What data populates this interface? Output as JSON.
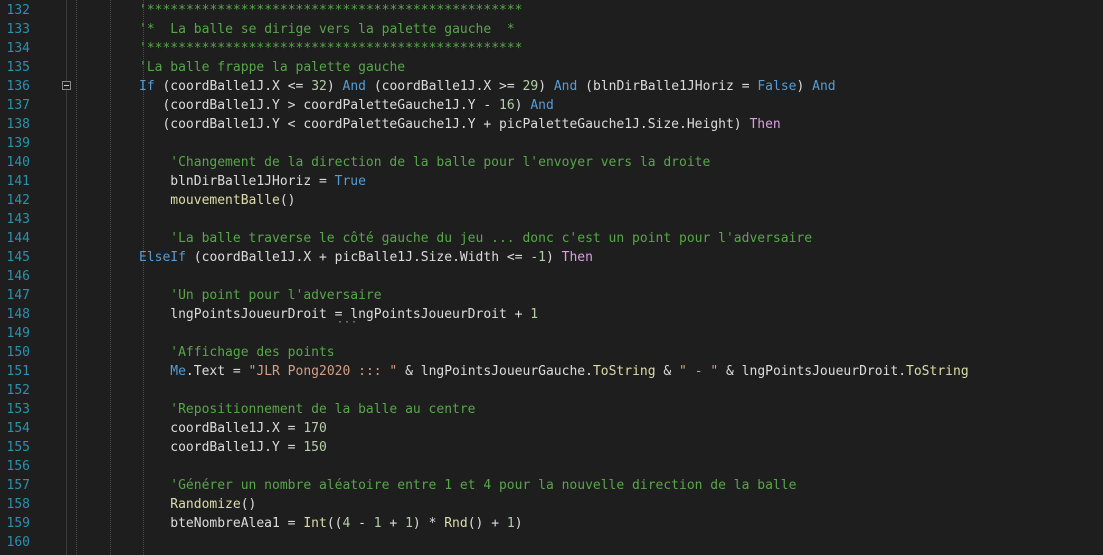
{
  "editor": {
    "lines": [
      {
        "n": "132",
        "indent": 0,
        "tokens": [
          {
            "t": "c",
            "v": "'************************************************"
          }
        ]
      },
      {
        "n": "133",
        "indent": 0,
        "tokens": [
          {
            "t": "c",
            "v": "'*  La balle se dirige vers la palette gauche  *"
          }
        ]
      },
      {
        "n": "134",
        "indent": 0,
        "tokens": [
          {
            "t": "c",
            "v": "'************************************************"
          }
        ]
      },
      {
        "n": "135",
        "indent": 0,
        "tokens": [
          {
            "t": "c",
            "v": "'La balle frappe la palette gauche"
          }
        ]
      },
      {
        "n": "136",
        "indent": 0,
        "fold": true,
        "tokens": [
          {
            "t": "k",
            "v": "If"
          },
          {
            "t": "x",
            "v": " (coordBalle1J.X <= "
          },
          {
            "t": "n",
            "v": "32"
          },
          {
            "t": "x",
            "v": ") "
          },
          {
            "t": "k",
            "v": "And"
          },
          {
            "t": "x",
            "v": " (coordBalle1J.X >= "
          },
          {
            "t": "n",
            "v": "29"
          },
          {
            "t": "x",
            "v": ") "
          },
          {
            "t": "k",
            "v": "And"
          },
          {
            "t": "x",
            "v": " (blnDirBalle1JHoriz = "
          },
          {
            "t": "k",
            "v": "False"
          },
          {
            "t": "x",
            "v": ") "
          },
          {
            "t": "k",
            "v": "And"
          }
        ]
      },
      {
        "n": "137",
        "indent": 3,
        "tokens": [
          {
            "t": "x",
            "v": "(coordBalle1J.Y > coordPaletteGauche1J.Y - "
          },
          {
            "t": "n",
            "v": "16"
          },
          {
            "t": "x",
            "v": ") "
          },
          {
            "t": "k",
            "v": "And"
          }
        ]
      },
      {
        "n": "138",
        "indent": 3,
        "tokens": [
          {
            "t": "x",
            "v": "(coordBalle1J.Y < coordPaletteGauche1J.Y + picPaletteGauche1J.Size.Height) "
          },
          {
            "t": "p",
            "v": "Then"
          }
        ]
      },
      {
        "n": "139",
        "indent": 0,
        "tokens": []
      },
      {
        "n": "140",
        "indent": 4,
        "tokens": [
          {
            "t": "c",
            "v": "'Changement de la direction de la balle pour l'envoyer vers la droite"
          }
        ]
      },
      {
        "n": "141",
        "indent": 4,
        "tokens": [
          {
            "t": "x",
            "v": "blnDirBalle1JHoriz = "
          },
          {
            "t": "k",
            "v": "True"
          }
        ]
      },
      {
        "n": "142",
        "indent": 4,
        "tokens": [
          {
            "t": "m",
            "v": "mouvementBalle"
          },
          {
            "t": "x",
            "v": "()"
          }
        ]
      },
      {
        "n": "143",
        "indent": 0,
        "tokens": []
      },
      {
        "n": "144",
        "indent": 4,
        "tokens": [
          {
            "t": "c",
            "v": "'La balle traverse le côté gauche du jeu ... donc c'est un point pour l'adversaire"
          }
        ]
      },
      {
        "n": "145",
        "indent": 0,
        "tokens": [
          {
            "t": "k",
            "v": "ElseIf"
          },
          {
            "t": "x",
            "v": " (coordBalle1J.X + picBalle1J.Size.Width <= "
          },
          {
            "t": "n",
            "v": "-1"
          },
          {
            "t": "x",
            "v": ") "
          },
          {
            "t": "p",
            "v": "Then"
          }
        ]
      },
      {
        "n": "146",
        "indent": 0,
        "tokens": []
      },
      {
        "n": "147",
        "indent": 4,
        "tokens": [
          {
            "t": "c",
            "v": "'Un point pour l'adversaire"
          }
        ]
      },
      {
        "n": "148",
        "indent": 4,
        "squiggle": true,
        "tokens": [
          {
            "t": "x",
            "v": "lngPointsJoueurDroit = lngPointsJoueurDroit + "
          },
          {
            "t": "n",
            "v": "1"
          }
        ]
      },
      {
        "n": "149",
        "indent": 0,
        "tokens": []
      },
      {
        "n": "150",
        "indent": 4,
        "tokens": [
          {
            "t": "c",
            "v": "'Affichage des points"
          }
        ]
      },
      {
        "n": "151",
        "indent": 4,
        "tokens": [
          {
            "t": "k",
            "v": "Me"
          },
          {
            "t": "x",
            "v": ".Text = "
          },
          {
            "t": "s",
            "v": "\"JLR Pong2020 ::: \""
          },
          {
            "t": "x",
            "v": " & lngPointsJoueurGauche."
          },
          {
            "t": "m",
            "v": "ToString"
          },
          {
            "t": "x",
            "v": " & "
          },
          {
            "t": "s",
            "v": "\" - \""
          },
          {
            "t": "x",
            "v": " & lngPointsJoueurDroit."
          },
          {
            "t": "m",
            "v": "ToString"
          }
        ]
      },
      {
        "n": "152",
        "indent": 0,
        "tokens": []
      },
      {
        "n": "153",
        "indent": 4,
        "tokens": [
          {
            "t": "c",
            "v": "'Repositionnement de la balle au centre"
          }
        ]
      },
      {
        "n": "154",
        "indent": 4,
        "tokens": [
          {
            "t": "x",
            "v": "coordBalle1J.X = "
          },
          {
            "t": "n",
            "v": "170"
          }
        ]
      },
      {
        "n": "155",
        "indent": 4,
        "tokens": [
          {
            "t": "x",
            "v": "coordBalle1J.Y = "
          },
          {
            "t": "n",
            "v": "150"
          }
        ]
      },
      {
        "n": "156",
        "indent": 0,
        "tokens": []
      },
      {
        "n": "157",
        "indent": 4,
        "tokens": [
          {
            "t": "c",
            "v": "'Générer un nombre aléatoire entre 1 et 4 pour la nouvelle direction de la balle"
          }
        ]
      },
      {
        "n": "158",
        "indent": 4,
        "tokens": [
          {
            "t": "m",
            "v": "Randomize"
          },
          {
            "t": "x",
            "v": "()"
          }
        ]
      },
      {
        "n": "159",
        "indent": 4,
        "tokens": [
          {
            "t": "x",
            "v": "bteNombreAlea1 = "
          },
          {
            "t": "m",
            "v": "Int"
          },
          {
            "t": "x",
            "v": "(("
          },
          {
            "t": "n",
            "v": "4"
          },
          {
            "t": "x",
            "v": " - "
          },
          {
            "t": "n",
            "v": "1"
          },
          {
            "t": "x",
            "v": " + "
          },
          {
            "t": "n",
            "v": "1"
          },
          {
            "t": "x",
            "v": ") * "
          },
          {
            "t": "m",
            "v": "Rnd"
          },
          {
            "t": "x",
            "v": "() + "
          },
          {
            "t": "n",
            "v": "1"
          },
          {
            "t": "x",
            "v": ")"
          }
        ]
      },
      {
        "n": "160",
        "indent": 0,
        "tokens": []
      }
    ]
  }
}
